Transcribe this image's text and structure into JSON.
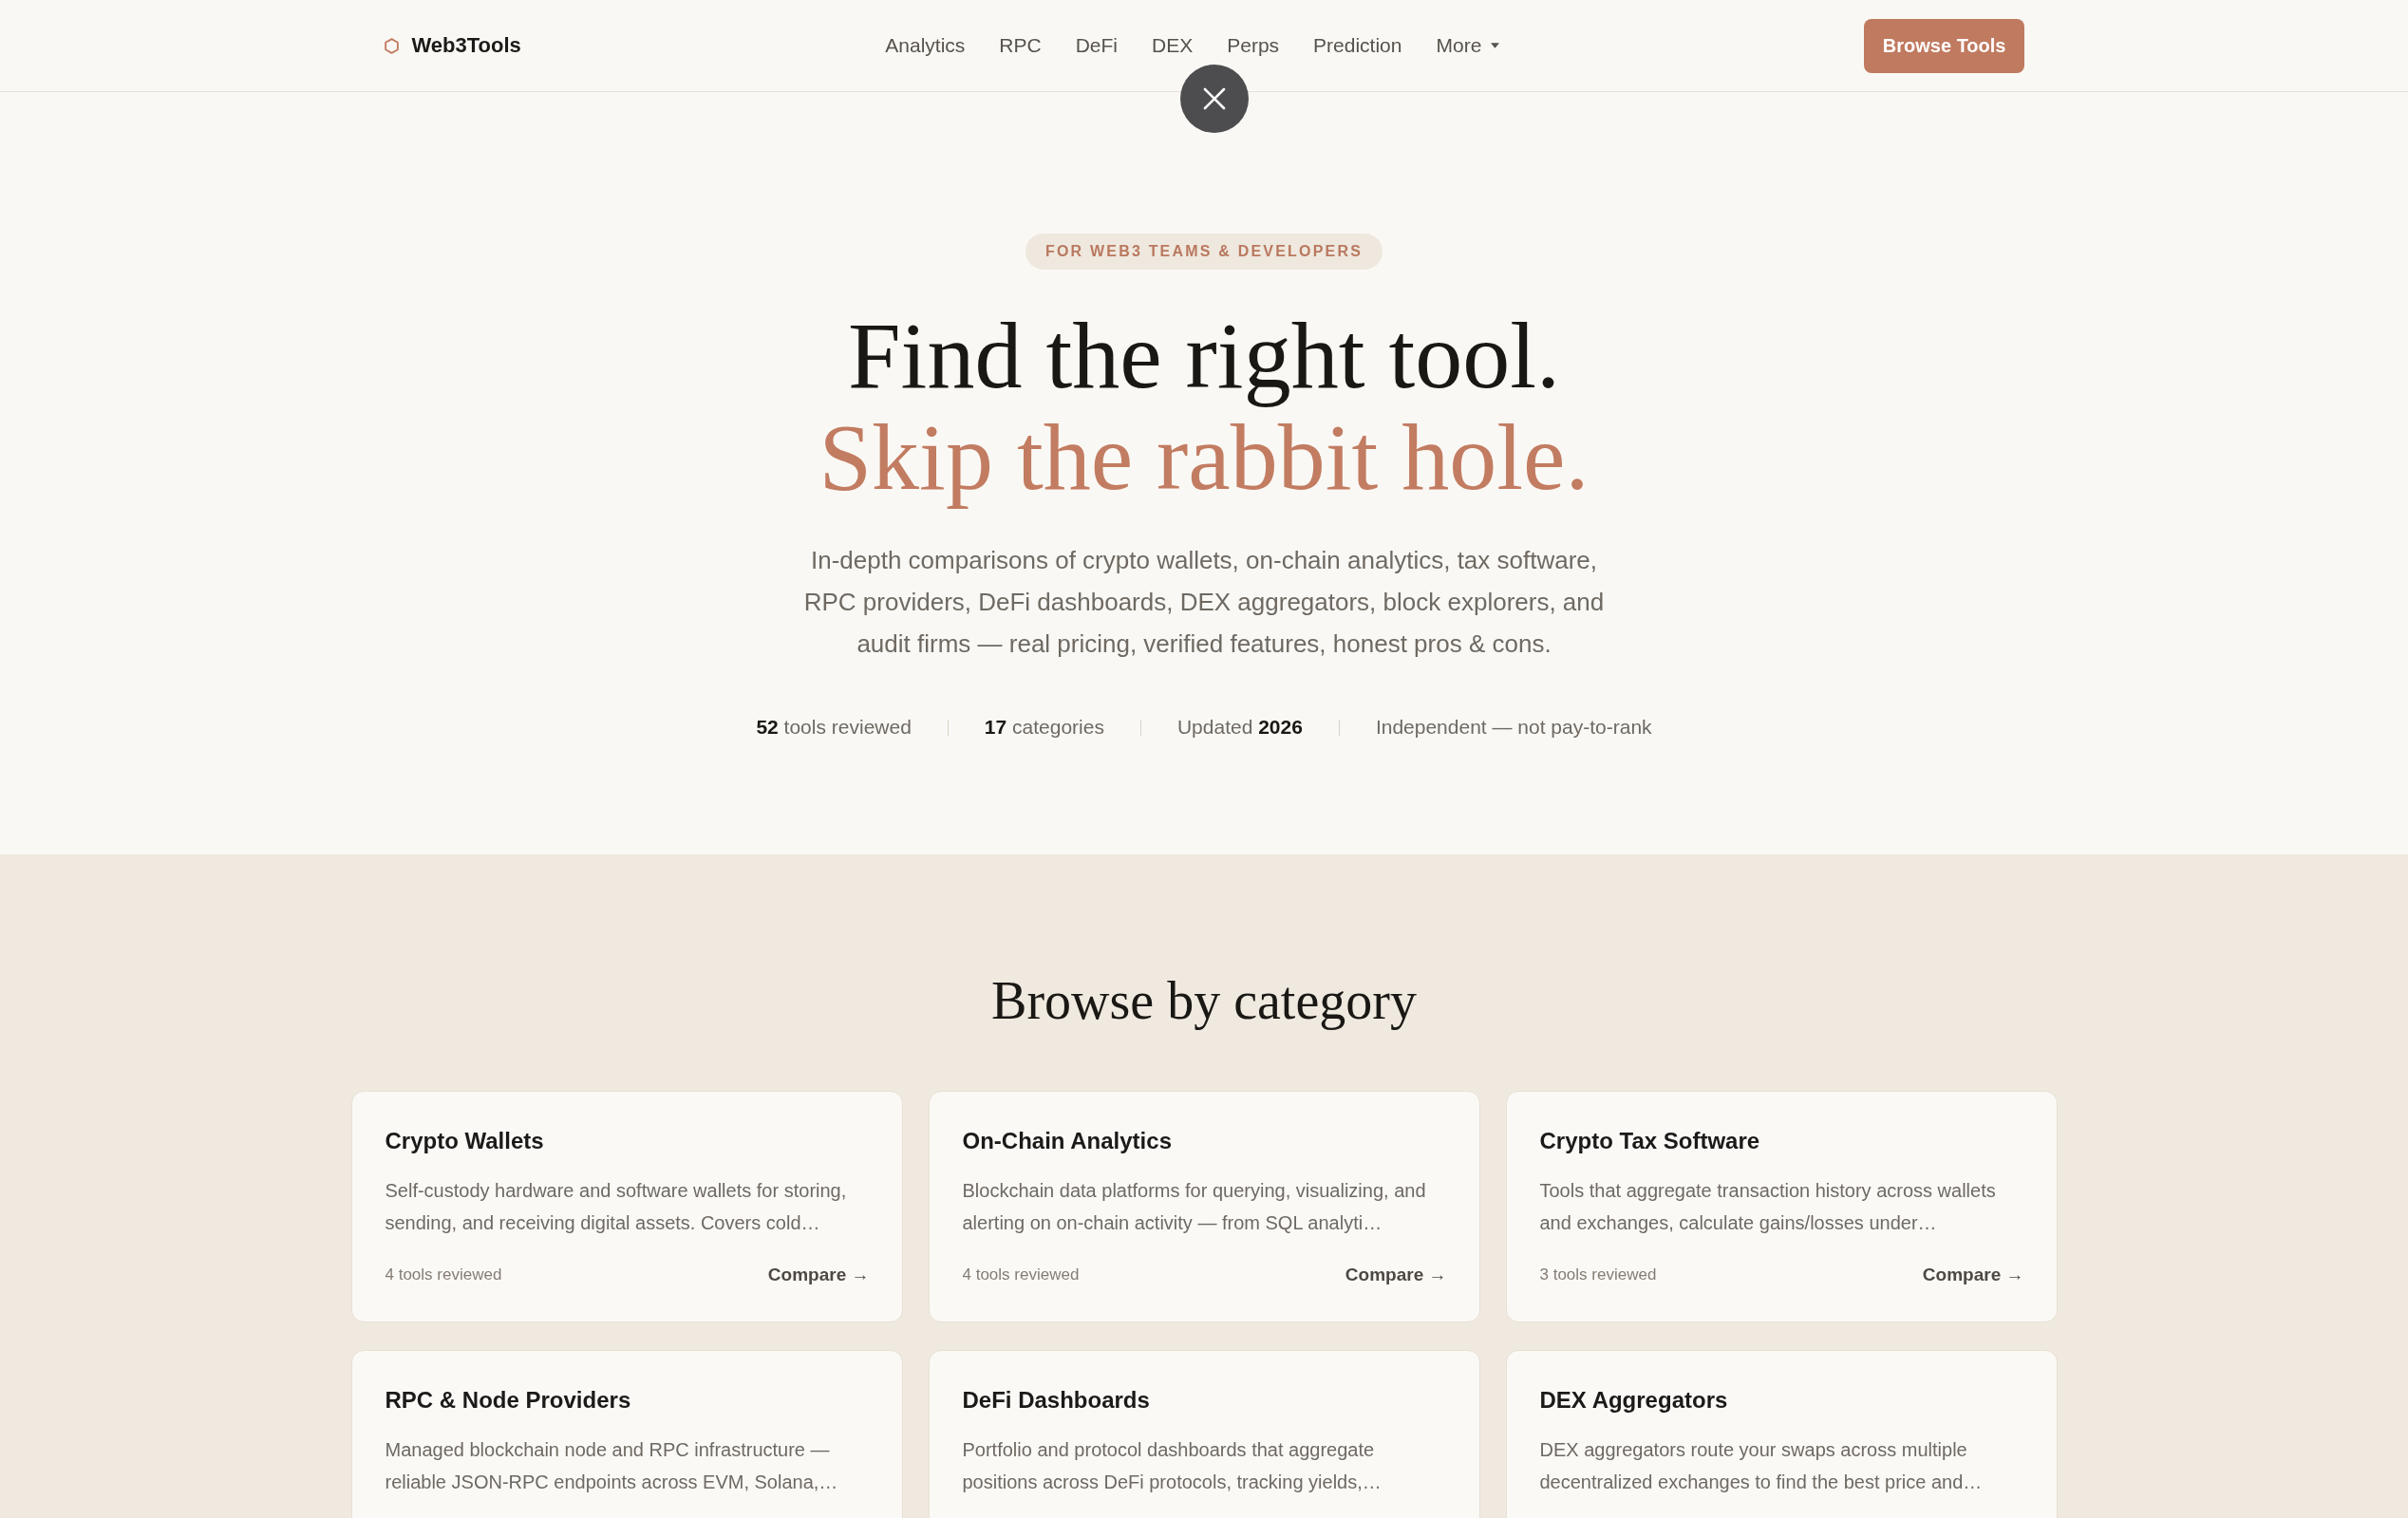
{
  "nav": {
    "logo": "Web3Tools",
    "links": [
      {
        "label": "Analytics",
        "kind": "link"
      },
      {
        "label": "RPC",
        "kind": "link"
      },
      {
        "label": "DeFi",
        "kind": "link"
      },
      {
        "label": "DEX",
        "kind": "link"
      },
      {
        "label": "Perps",
        "kind": "link"
      },
      {
        "label": "Prediction",
        "kind": "link"
      },
      {
        "label": "More",
        "kind": "dropdown"
      }
    ],
    "cta": "Browse Tools"
  },
  "hero": {
    "badge": "FOR WEB3 TEAMS & DEVELOPERS",
    "title": "Find the right tool.",
    "title_accent": "Skip the rabbit hole.",
    "description": "In-depth comparisons of crypto wallets, on-chain analytics, tax software, RPC providers, DeFi dashboards, DEX aggregators, block explorers, and audit firms — real pricing, verified features, honest pros & cons.",
    "stats": [
      "**52** tools reviewed",
      "**17** categories",
      "Updated **2026**",
      "Independent — not pay-to-rank"
    ]
  },
  "categories": {
    "title": "Browse by category",
    "cards": [
      {
        "title": "Crypto Wallets",
        "description": "Self-custody hardware and software wallets for storing, sending, and receiving digital assets. Covers cold…",
        "count": "4 tools reviewed",
        "action": "Compare →"
      },
      {
        "title": "On-Chain Analytics",
        "description": "Blockchain data platforms for querying, visualizing, and alerting on on-chain activity — from SQL analyti…",
        "count": "4 tools reviewed",
        "action": "Compare →"
      },
      {
        "title": "Crypto Tax Software",
        "description": "Tools that aggregate transaction history across wallets and exchanges, calculate gains/losses under…",
        "count": "3 tools reviewed",
        "action": "Compare →"
      },
      {
        "title": "RPC & Node Providers",
        "description": "Managed blockchain node and RPC infrastructure — reliable JSON-RPC endpoints across EVM, Solana,…"
      },
      {
        "title": "DeFi Dashboards",
        "description": "Portfolio and protocol dashboards that aggregate positions across DeFi protocols, tracking yields,…"
      },
      {
        "title": "DEX Aggregators",
        "description": "DEX aggregators route your swaps across multiple decentralized exchanges to find the best price and…"
      }
    ]
  }
}
